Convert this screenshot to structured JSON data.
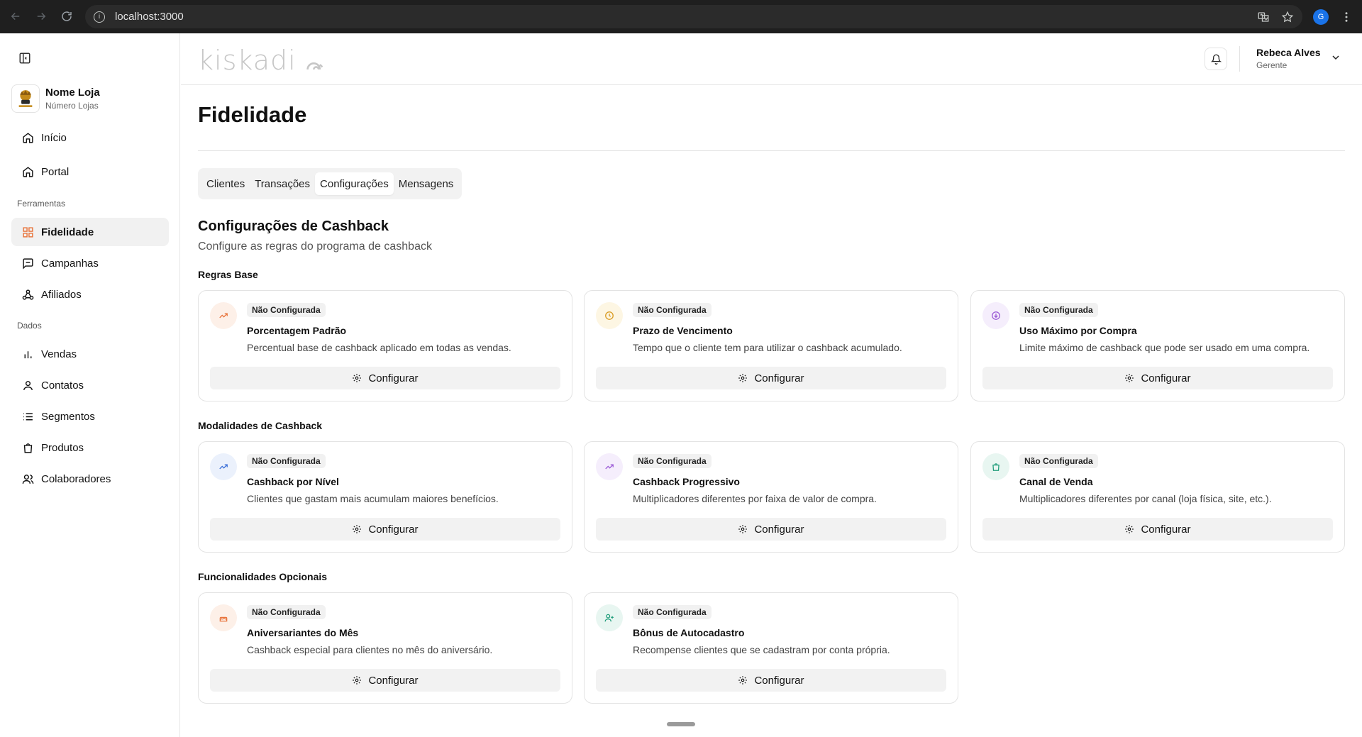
{
  "browser": {
    "url": "localhost:3000",
    "profile_initial": "G"
  },
  "sidebar": {
    "store_name": "Nome Loja",
    "store_sub": "Número Lojas",
    "top_items": [
      {
        "label": "Início",
        "icon": "home-icon"
      },
      {
        "label": "Portal",
        "icon": "home-icon"
      }
    ],
    "section_tools": "Ferramentas",
    "tools": [
      {
        "label": "Fidelidade",
        "icon": "grid-icon",
        "active": true
      },
      {
        "label": "Campanhas",
        "icon": "message-icon"
      },
      {
        "label": "Afiliados",
        "icon": "network-icon"
      }
    ],
    "section_data": "Dados",
    "data_items": [
      {
        "label": "Vendas",
        "icon": "bar-chart-icon"
      },
      {
        "label": "Contatos",
        "icon": "user-icon"
      },
      {
        "label": "Segmentos",
        "icon": "list-icon"
      },
      {
        "label": "Produtos",
        "icon": "bag-icon"
      },
      {
        "label": "Colaboradores",
        "icon": "users-icon"
      }
    ]
  },
  "header": {
    "brand": "kiskadi",
    "user_name": "Rebeca Alves",
    "user_role": "Gerente"
  },
  "main": {
    "page_title": "Fidelidade",
    "tabs": [
      {
        "label": "Clientes"
      },
      {
        "label": "Transações"
      },
      {
        "label": "Configurações",
        "active": true
      },
      {
        "label": "Mensagens"
      }
    ],
    "section_title": "Configurações de Cashback",
    "section_sub": "Configure as regras do programa de cashback",
    "groups": [
      {
        "title": "Regras Base",
        "cards": [
          {
            "status": "Não Configurada",
            "title": "Porcentagem Padrão",
            "desc": "Percentual base de cashback aplicado em todas as vendas.",
            "button": "Configurar",
            "icon": "trending-up-icon",
            "color": "#e8733a",
            "bg": "#fdf0e8"
          },
          {
            "status": "Não Configurada",
            "title": "Prazo de Vencimento",
            "desc": "Tempo que o cliente tem para utilizar o cashback acumulado.",
            "button": "Configurar",
            "icon": "clock-icon",
            "color": "#d99a1e",
            "bg": "#fdf6e3"
          },
          {
            "status": "Não Configurada",
            "title": "Uso Máximo por Compra",
            "desc": "Limite máximo de cashback que pode ser usado em uma compra.",
            "button": "Configurar",
            "icon": "download-circle-icon",
            "color": "#9b5bd6",
            "bg": "#f5eefc"
          }
        ]
      },
      {
        "title": "Modalidades de Cashback",
        "cards": [
          {
            "status": "Não Configurada",
            "title": "Cashback por Nível",
            "desc": "Clientes que gastam mais acumulam maiores benefícios.",
            "button": "Configurar",
            "icon": "trending-up-icon",
            "color": "#3b6fd8",
            "bg": "#ebf1fc"
          },
          {
            "status": "Não Configurada",
            "title": "Cashback Progressivo",
            "desc": "Multiplicadores diferentes por faixa de valor de compra.",
            "button": "Configurar",
            "icon": "trending-up-icon",
            "color": "#9b5bd6",
            "bg": "#f5eefc"
          },
          {
            "status": "Não Configurada",
            "title": "Canal de Venda",
            "desc": "Multiplicadores diferentes por canal (loja física, site, etc.).",
            "button": "Configurar",
            "icon": "bag-icon",
            "color": "#1f9d7a",
            "bg": "#e8f6f1"
          }
        ]
      },
      {
        "title": "Funcionalidades Opcionais",
        "cards": [
          {
            "status": "Não Configurada",
            "title": "Aniversariantes do Mês",
            "desc": "Cashback especial para clientes no mês do aniversário.",
            "button": "Configurar",
            "icon": "cake-icon",
            "color": "#e8733a",
            "bg": "#fdf0e8"
          },
          {
            "status": "Não Configurada",
            "title": "Bônus de Autocadastro",
            "desc": "Recompense clientes que se cadastram por conta própria.",
            "button": "Configurar",
            "icon": "user-plus-icon",
            "color": "#1f9d7a",
            "bg": "#e8f6f1"
          }
        ]
      }
    ]
  }
}
